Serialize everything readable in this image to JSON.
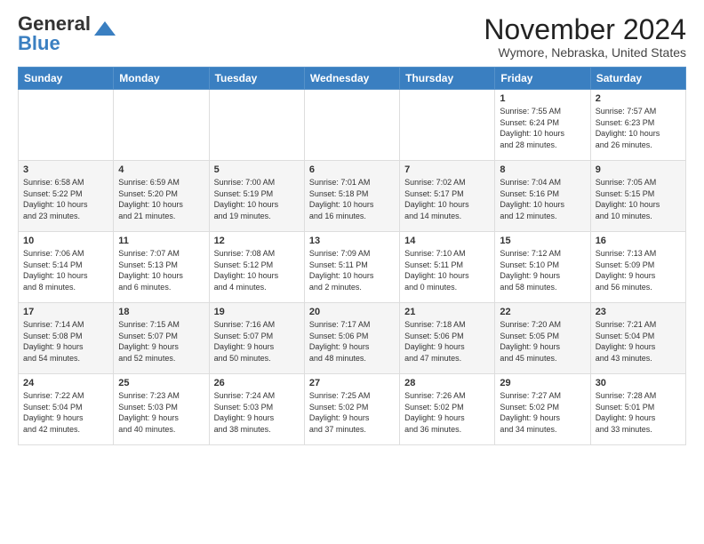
{
  "header": {
    "logo_general": "General",
    "logo_blue": "Blue",
    "title": "November 2024",
    "location": "Wymore, Nebraska, United States"
  },
  "weekdays": [
    "Sunday",
    "Monday",
    "Tuesday",
    "Wednesday",
    "Thursday",
    "Friday",
    "Saturday"
  ],
  "weeks": [
    [
      {
        "day": "",
        "info": ""
      },
      {
        "day": "",
        "info": ""
      },
      {
        "day": "",
        "info": ""
      },
      {
        "day": "",
        "info": ""
      },
      {
        "day": "",
        "info": ""
      },
      {
        "day": "1",
        "info": "Sunrise: 7:55 AM\nSunset: 6:24 PM\nDaylight: 10 hours\nand 28 minutes."
      },
      {
        "day": "2",
        "info": "Sunrise: 7:57 AM\nSunset: 6:23 PM\nDaylight: 10 hours\nand 26 minutes."
      }
    ],
    [
      {
        "day": "3",
        "info": "Sunrise: 6:58 AM\nSunset: 5:22 PM\nDaylight: 10 hours\nand 23 minutes."
      },
      {
        "day": "4",
        "info": "Sunrise: 6:59 AM\nSunset: 5:20 PM\nDaylight: 10 hours\nand 21 minutes."
      },
      {
        "day": "5",
        "info": "Sunrise: 7:00 AM\nSunset: 5:19 PM\nDaylight: 10 hours\nand 19 minutes."
      },
      {
        "day": "6",
        "info": "Sunrise: 7:01 AM\nSunset: 5:18 PM\nDaylight: 10 hours\nand 16 minutes."
      },
      {
        "day": "7",
        "info": "Sunrise: 7:02 AM\nSunset: 5:17 PM\nDaylight: 10 hours\nand 14 minutes."
      },
      {
        "day": "8",
        "info": "Sunrise: 7:04 AM\nSunset: 5:16 PM\nDaylight: 10 hours\nand 12 minutes."
      },
      {
        "day": "9",
        "info": "Sunrise: 7:05 AM\nSunset: 5:15 PM\nDaylight: 10 hours\nand 10 minutes."
      }
    ],
    [
      {
        "day": "10",
        "info": "Sunrise: 7:06 AM\nSunset: 5:14 PM\nDaylight: 10 hours\nand 8 minutes."
      },
      {
        "day": "11",
        "info": "Sunrise: 7:07 AM\nSunset: 5:13 PM\nDaylight: 10 hours\nand 6 minutes."
      },
      {
        "day": "12",
        "info": "Sunrise: 7:08 AM\nSunset: 5:12 PM\nDaylight: 10 hours\nand 4 minutes."
      },
      {
        "day": "13",
        "info": "Sunrise: 7:09 AM\nSunset: 5:11 PM\nDaylight: 10 hours\nand 2 minutes."
      },
      {
        "day": "14",
        "info": "Sunrise: 7:10 AM\nSunset: 5:11 PM\nDaylight: 10 hours\nand 0 minutes."
      },
      {
        "day": "15",
        "info": "Sunrise: 7:12 AM\nSunset: 5:10 PM\nDaylight: 9 hours\nand 58 minutes."
      },
      {
        "day": "16",
        "info": "Sunrise: 7:13 AM\nSunset: 5:09 PM\nDaylight: 9 hours\nand 56 minutes."
      }
    ],
    [
      {
        "day": "17",
        "info": "Sunrise: 7:14 AM\nSunset: 5:08 PM\nDaylight: 9 hours\nand 54 minutes."
      },
      {
        "day": "18",
        "info": "Sunrise: 7:15 AM\nSunset: 5:07 PM\nDaylight: 9 hours\nand 52 minutes."
      },
      {
        "day": "19",
        "info": "Sunrise: 7:16 AM\nSunset: 5:07 PM\nDaylight: 9 hours\nand 50 minutes."
      },
      {
        "day": "20",
        "info": "Sunrise: 7:17 AM\nSunset: 5:06 PM\nDaylight: 9 hours\nand 48 minutes."
      },
      {
        "day": "21",
        "info": "Sunrise: 7:18 AM\nSunset: 5:06 PM\nDaylight: 9 hours\nand 47 minutes."
      },
      {
        "day": "22",
        "info": "Sunrise: 7:20 AM\nSunset: 5:05 PM\nDaylight: 9 hours\nand 45 minutes."
      },
      {
        "day": "23",
        "info": "Sunrise: 7:21 AM\nSunset: 5:04 PM\nDaylight: 9 hours\nand 43 minutes."
      }
    ],
    [
      {
        "day": "24",
        "info": "Sunrise: 7:22 AM\nSunset: 5:04 PM\nDaylight: 9 hours\nand 42 minutes."
      },
      {
        "day": "25",
        "info": "Sunrise: 7:23 AM\nSunset: 5:03 PM\nDaylight: 9 hours\nand 40 minutes."
      },
      {
        "day": "26",
        "info": "Sunrise: 7:24 AM\nSunset: 5:03 PM\nDaylight: 9 hours\nand 38 minutes."
      },
      {
        "day": "27",
        "info": "Sunrise: 7:25 AM\nSunset: 5:02 PM\nDaylight: 9 hours\nand 37 minutes."
      },
      {
        "day": "28",
        "info": "Sunrise: 7:26 AM\nSunset: 5:02 PM\nDaylight: 9 hours\nand 36 minutes."
      },
      {
        "day": "29",
        "info": "Sunrise: 7:27 AM\nSunset: 5:02 PM\nDaylight: 9 hours\nand 34 minutes."
      },
      {
        "day": "30",
        "info": "Sunrise: 7:28 AM\nSunset: 5:01 PM\nDaylight: 9 hours\nand 33 minutes."
      }
    ]
  ]
}
